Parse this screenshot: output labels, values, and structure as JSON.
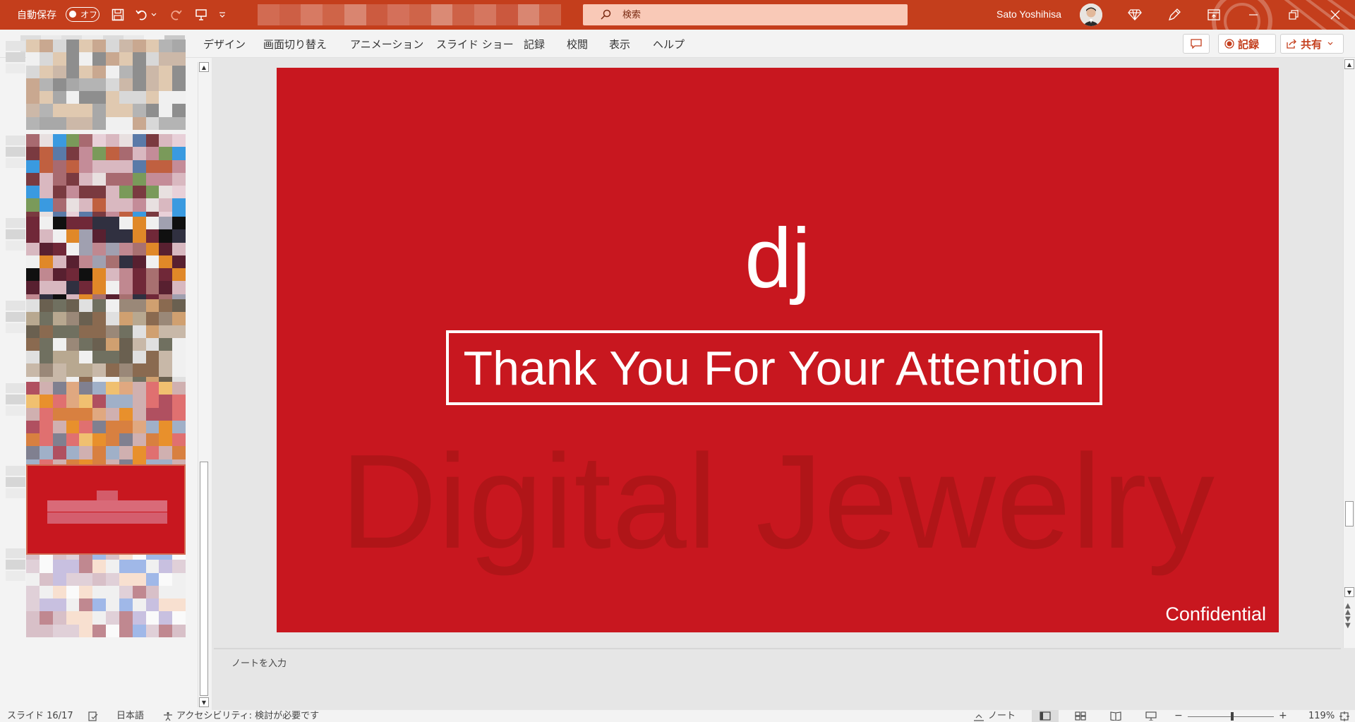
{
  "titlebar": {
    "autosave_label": "自動保存",
    "autosave_state": "オフ",
    "search_placeholder": "検索",
    "user_name": "Sato Yoshihisa"
  },
  "ribbon": {
    "tabs": [
      "デザイン",
      "画面切り替え",
      "アニメーション",
      "スライド ショー",
      "記録",
      "校閲",
      "表示",
      "ヘルプ"
    ],
    "record_label": "記録",
    "share_label": "共有"
  },
  "slide": {
    "logo_text": "dj",
    "headline": "Thank You For Your Attention",
    "watermark": "Digital Jewelry",
    "footer": "Confidential",
    "background_color": "#c8171f"
  },
  "notes": {
    "placeholder": "ノートを入力"
  },
  "statusbar": {
    "slide_counter": "スライド 16/17",
    "language": "日本語",
    "accessibility": "アクセシビリティ: 検討が必要です",
    "notes_label": "ノート",
    "zoom": "119%"
  }
}
